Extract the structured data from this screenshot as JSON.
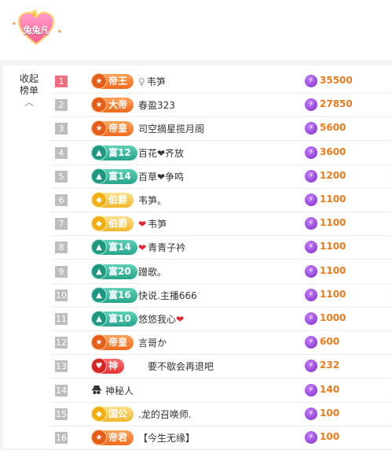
{
  "header": {
    "logo_text": "兔兔凡"
  },
  "sidebar": {
    "collapse_label_line1": "收起",
    "collapse_label_line2": "榜单"
  },
  "rows": [
    {
      "rank": "1",
      "badge": "帝王",
      "badge_style": "orange",
      "badge_icon": "★",
      "name": "韦笋",
      "prefix": "♀",
      "suffix_heart": false,
      "amount": "35500"
    },
    {
      "rank": "2",
      "badge": "大帝",
      "badge_style": "orange",
      "badge_icon": "★",
      "name": "春盈323",
      "prefix": "",
      "suffix_heart": false,
      "amount": "27850"
    },
    {
      "rank": "3",
      "badge": "帝皇",
      "badge_style": "orange",
      "badge_icon": "★",
      "name": "司空摘星揽月阁",
      "prefix": "",
      "suffix_heart": false,
      "amount": "5600"
    },
    {
      "rank": "4",
      "badge": "富12",
      "badge_style": "teal",
      "badge_icon": "▲",
      "name": "百花❤齐放",
      "prefix": "",
      "suffix_heart": false,
      "amount": "3600"
    },
    {
      "rank": "5",
      "badge": "富14",
      "badge_style": "teal",
      "badge_icon": "▲",
      "name": "百草❤争鸣",
      "prefix": "",
      "suffix_heart": false,
      "amount": "1200"
    },
    {
      "rank": "6",
      "badge": "伯爵",
      "badge_style": "gold",
      "badge_icon": "◆",
      "name": "韦笋。",
      "prefix": "",
      "suffix_heart": false,
      "amount": "1100"
    },
    {
      "rank": "7",
      "badge": "伯爵",
      "badge_style": "gold",
      "badge_icon": "◆",
      "name": "韦笋",
      "prefix": "❤",
      "suffix_heart": false,
      "amount": "1100"
    },
    {
      "rank": "8",
      "badge": "富14",
      "badge_style": "teal",
      "badge_icon": "▲",
      "name": "青青子衿",
      "prefix": "❤",
      "suffix_heart": false,
      "amount": "1100"
    },
    {
      "rank": "9",
      "badge": "富20",
      "badge_style": "teal",
      "badge_icon": "▲",
      "name": "蹭歌。",
      "prefix": "",
      "suffix_heart": false,
      "amount": "1100"
    },
    {
      "rank": "10",
      "badge": "富16",
      "badge_style": "teal",
      "badge_icon": "▲",
      "name": "快说.主播666",
      "prefix": "",
      "suffix_heart": false,
      "amount": "1100"
    },
    {
      "rank": "11",
      "badge": "富10",
      "badge_style": "teal",
      "badge_icon": "▲",
      "name": "悠悠我心",
      "prefix": "",
      "suffix_heart": true,
      "amount": "1000"
    },
    {
      "rank": "12",
      "badge": "帝皇",
      "badge_style": "orange",
      "badge_icon": "★",
      "name": "言哥か",
      "prefix": "",
      "suffix_heart": false,
      "amount": "600"
    },
    {
      "rank": "13",
      "badge": "神",
      "badge_style": "red",
      "badge_icon": "♥",
      "name": "要不歇会再退吧",
      "prefix": "",
      "suffix_heart": false,
      "amount": "232"
    },
    {
      "rank": "14",
      "badge": "",
      "badge_style": "none",
      "badge_icon": "",
      "name": "神秘人",
      "prefix": "",
      "suffix_heart": false,
      "amount": "140"
    },
    {
      "rank": "15",
      "badge": "国公",
      "badge_style": "gold",
      "badge_icon": "◆",
      "name": ".龙的召唤师.",
      "prefix": "",
      "suffix_heart": false,
      "amount": "100"
    },
    {
      "rank": "16",
      "badge": "帝君",
      "badge_style": "orange",
      "badge_icon": "★",
      "name": "【今生无缘】",
      "prefix": "",
      "suffix_heart": false,
      "amount": "100"
    }
  ]
}
